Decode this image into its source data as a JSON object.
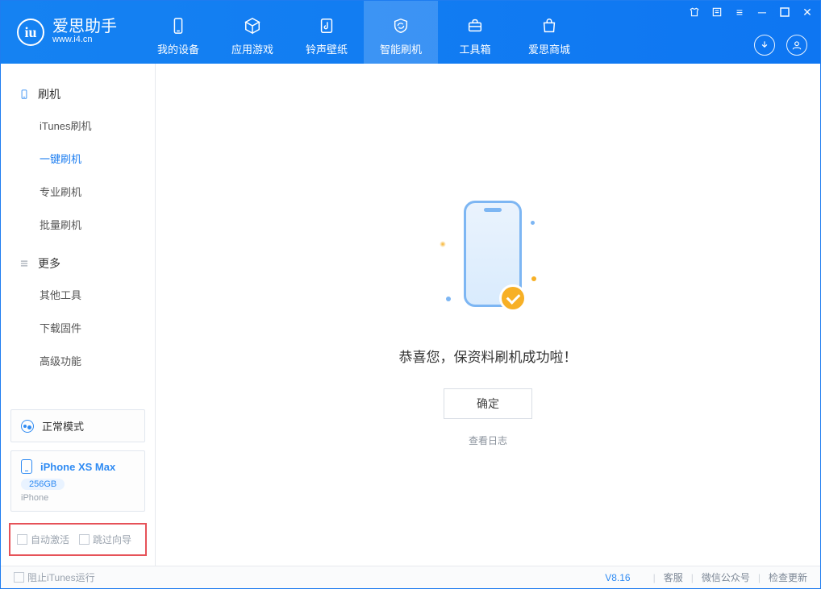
{
  "app": {
    "name": "爱思助手",
    "url": "www.i4.cn"
  },
  "nav": {
    "items": [
      {
        "label": "我的设备"
      },
      {
        "label": "应用游戏"
      },
      {
        "label": "铃声壁纸"
      },
      {
        "label": "智能刷机"
      },
      {
        "label": "工具箱"
      },
      {
        "label": "爱思商城"
      }
    ]
  },
  "sidebar": {
    "group1": {
      "title": "刷机",
      "items": [
        {
          "label": "iTunes刷机"
        },
        {
          "label": "一键刷机"
        },
        {
          "label": "专业刷机"
        },
        {
          "label": "批量刷机"
        }
      ]
    },
    "group2": {
      "title": "更多",
      "items": [
        {
          "label": "其他工具"
        },
        {
          "label": "下载固件"
        },
        {
          "label": "高级功能"
        }
      ]
    },
    "mode_card": {
      "label": "正常模式"
    },
    "device_card": {
      "name": "iPhone XS Max",
      "storage": "256GB",
      "type": "iPhone"
    },
    "checks": {
      "auto_activate": "自动激活",
      "skip_guide": "跳过向导"
    }
  },
  "main": {
    "success_msg": "恭喜您，保资料刷机成功啦！",
    "ok_label": "确定",
    "log_link": "查看日志"
  },
  "footer": {
    "block_itunes": "阻止iTunes运行",
    "version": "V8.16",
    "links": {
      "kefu": "客服",
      "wechat": "微信公众号",
      "update": "检查更新"
    }
  }
}
